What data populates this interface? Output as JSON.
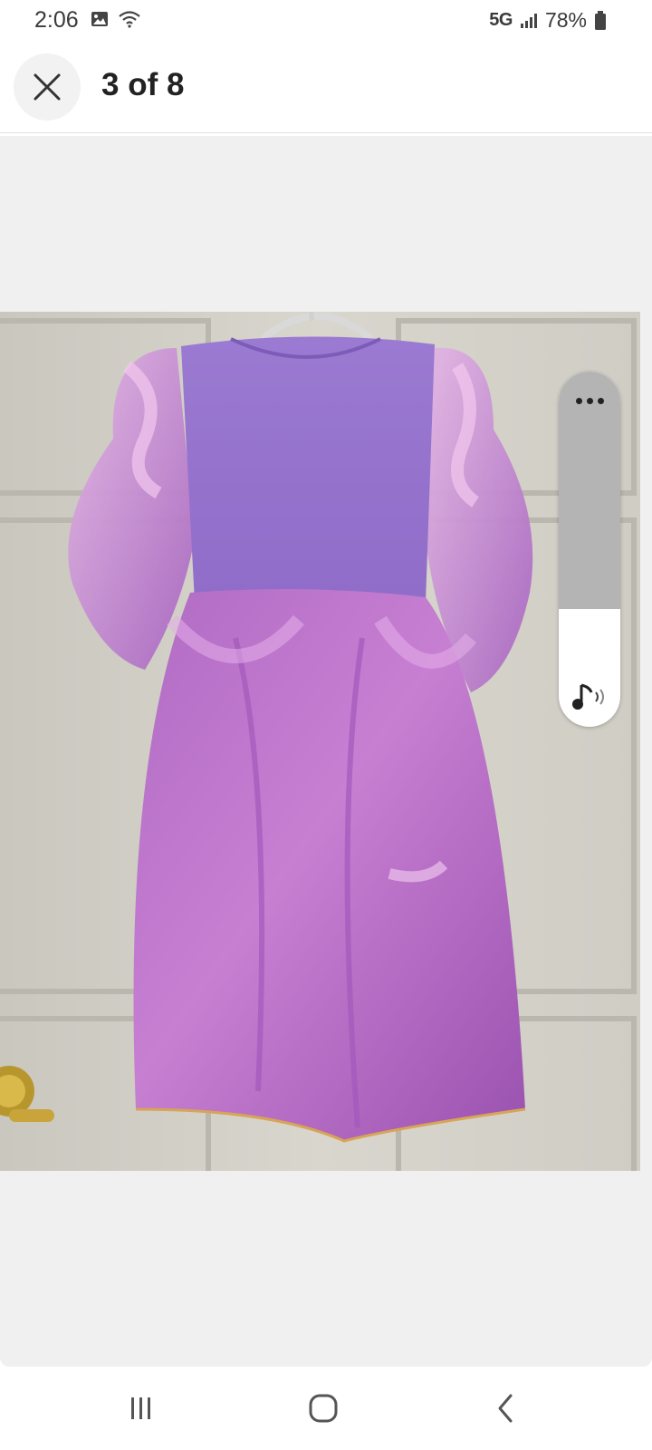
{
  "status_bar": {
    "time": "2:06",
    "network": "5G",
    "battery": "78%",
    "icons": [
      "image-icon",
      "wifi-icon",
      "signal-icon",
      "battery-icon"
    ]
  },
  "header": {
    "title": "3 of 8",
    "close_icon": "close-icon"
  },
  "viewer": {
    "image": "dress-photo",
    "current_index": 3,
    "total": 8
  },
  "float_panel": {
    "icons": [
      "more-icon",
      "sound-icon"
    ]
  },
  "nav_bar": {
    "icons": [
      "recents-icon",
      "home-icon",
      "back-icon"
    ]
  },
  "colors": {
    "viewer_bg": "#f0f0f0",
    "dress_purple": "#9a6ec8",
    "skirt_pink": "#b566c4",
    "door": "#d5d3ca"
  }
}
